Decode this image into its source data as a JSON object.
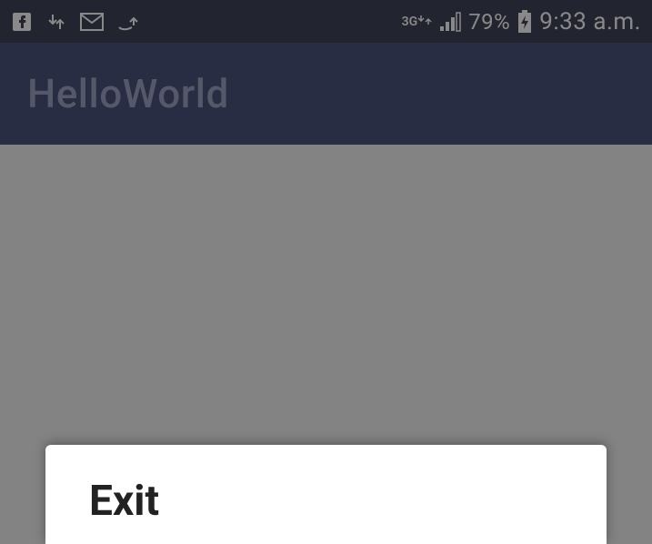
{
  "statusbar": {
    "network_label": "3G",
    "battery_pct": "79%",
    "time": "9:33 a.m."
  },
  "appbar": {
    "title": "HelloWorld"
  },
  "dialog": {
    "title": "Exit"
  }
}
